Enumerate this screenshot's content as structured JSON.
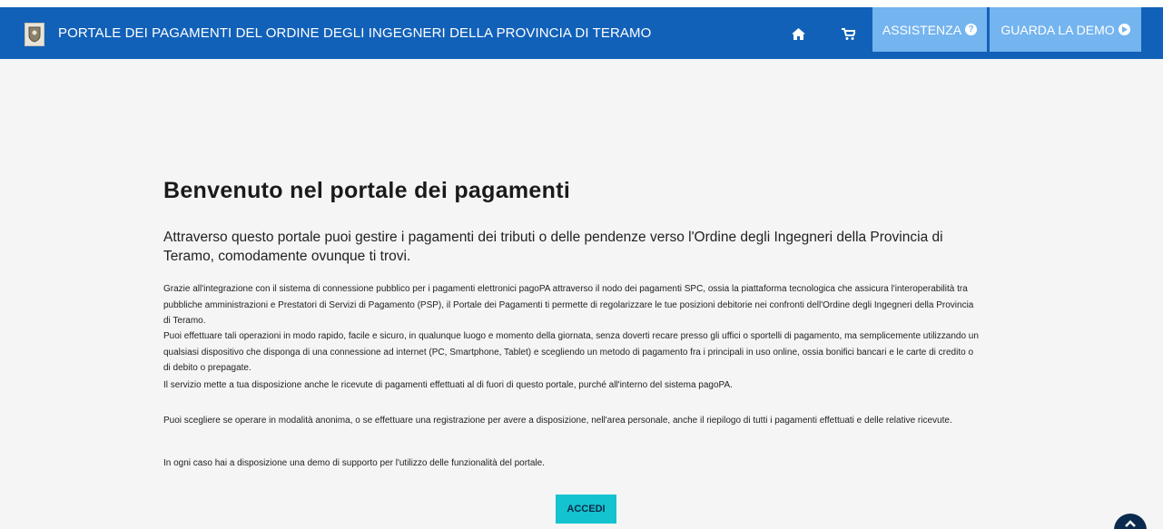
{
  "header": {
    "title": "PORTALE DEI PAGAMENTI DEL ORDINE DEGLI INGEGNERI DELLA PROVINCIA DI TERAMO",
    "home_icon": "home-icon",
    "cart_icon": "cart-icon",
    "assistenza_label": "ASSISTENZA",
    "demo_label": "GUARDA LA DEMO"
  },
  "main": {
    "heading": "Benvenuto nel portale dei pagamenti",
    "lead": "Attraverso questo portale puoi gestire i pagamenti dei tributi o delle pendenze verso l'Ordine degli Ingegneri della Provincia di Teramo, comodamente ovunque ti trovi.",
    "paragraph1": "Grazie all'integrazione con il sistema di connessione pubblico per i pagamenti elettronici pagoPA attraverso il nodo dei pagamenti SPC, ossia la piattaforma tecnologica che assicura l'interoperabilità tra pubbliche amministrazioni e Prestatori di Servizi di Pagamento (PSP), il Portale dei Pagamenti ti permette di regolarizzare le tue posizioni debitorie nei confronti dell'Ordine degli Ingegneri della Provincia di Teramo.",
    "paragraph2": "Puoi effettuare tali operazioni in modo rapido, facile e sicuro, in qualunque luogo e momento della giornata, senza doverti recare presso gli uffici o sportelli di pagamento, ma semplicemente utilizzando un qualsiasi dispositivo che disponga di una connessione ad internet (PC, Smartphone, Tablet) e scegliendo un metodo di pagamento fra i principali in uso online, ossia bonifici bancari e le carte di credito o di debito o prepagate.",
    "paragraph3": "Il servizio mette a tua disposizione anche le ricevute di pagamenti effettuati al di fuori di questo portale, purché all'interno del sistema pagoPA.",
    "paragraph4": "Puoi scegliere se operare in modalità anonima, o se effettuare una registrazione per avere a disposizione, nell'area personale, anche il riepilogo di tutti i pagamenti effettuati e delle relative ricevute.",
    "paragraph5": "In ogni caso hai a disposizione una demo di supporto per l'utilizzo delle funzionalità del portale.",
    "accedi_label": "ACCEDI"
  },
  "colors": {
    "navbar": "#1261b9",
    "nav_button": "#74b4ef",
    "accedi_button": "#13c3cf",
    "scroll_top": "#0a2b4d",
    "background": "#f5f5f5"
  },
  "icons": [
    "crest-logo",
    "home-icon",
    "cart-icon",
    "question-circle-icon",
    "play-circle-icon",
    "chevron-up-icon"
  ]
}
